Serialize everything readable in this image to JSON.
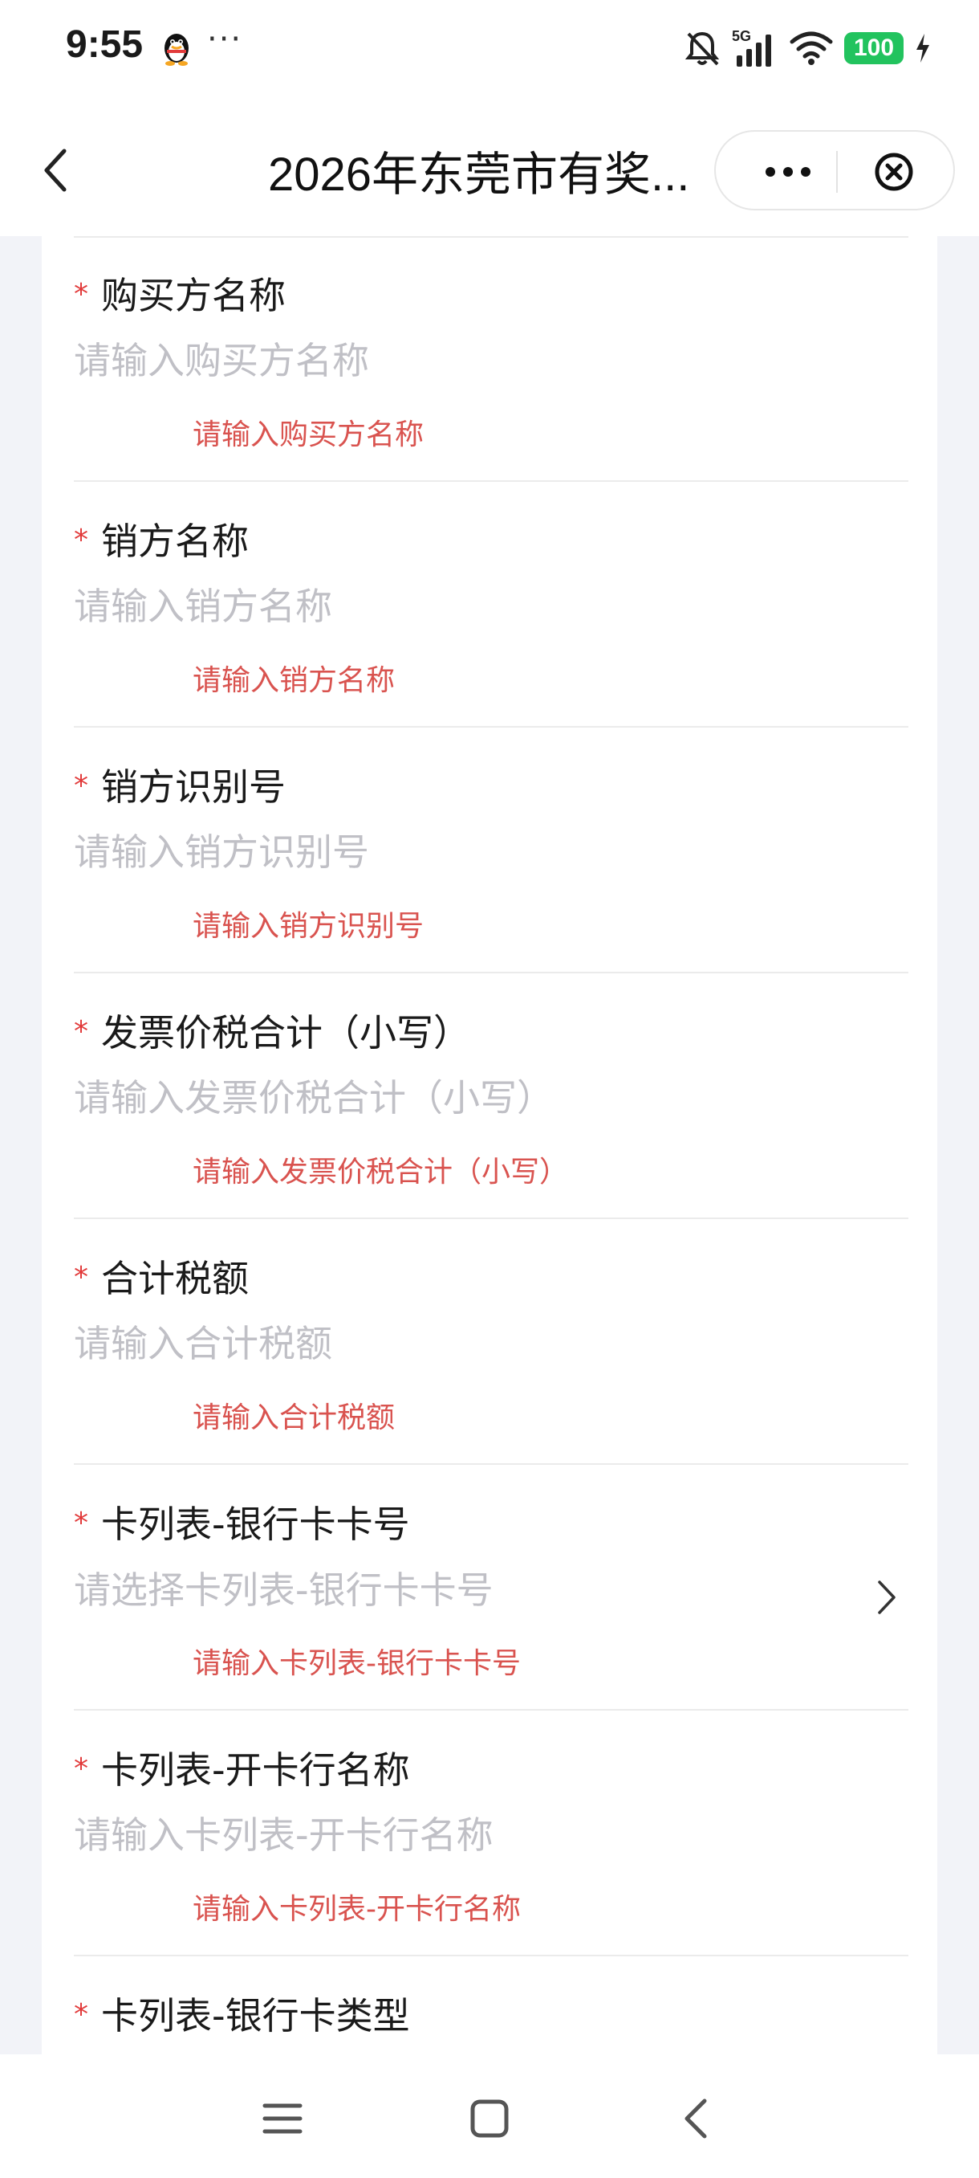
{
  "status_bar": {
    "time": "9:55",
    "dots": "···",
    "network": "5G",
    "battery": "100",
    "icons": [
      "qq-penguin-icon",
      "bell-muted-icon",
      "signal-icon",
      "wifi-icon",
      "battery-icon",
      "charging-bolt-icon"
    ]
  },
  "header": {
    "title": "2026年东莞市有奖...",
    "icons": [
      "back-arrow-icon",
      "more-dots-icon",
      "close-circle-icon"
    ]
  },
  "form": {
    "items": [
      {
        "label": "购买方名称",
        "placeholder": "请输入购买方名称",
        "error": "请输入购买方名称",
        "required": true,
        "type": "input"
      },
      {
        "label": "销方名称",
        "placeholder": "请输入销方名称",
        "error": "请输入销方名称",
        "required": true,
        "type": "input"
      },
      {
        "label": "销方识别号",
        "placeholder": "请输入销方识别号",
        "error": "请输入销方识别号",
        "required": true,
        "type": "input"
      },
      {
        "label": "发票价税合计（小写）",
        "placeholder": "请输入发票价税合计（小写）",
        "error": "请输入发票价税合计（小写）",
        "required": true,
        "type": "input"
      },
      {
        "label": "合计税额",
        "placeholder": "请输入合计税额",
        "error": "请输入合计税额",
        "required": true,
        "type": "input"
      },
      {
        "label": "卡列表-银行卡卡号",
        "placeholder": "请选择卡列表-银行卡卡号",
        "error": "请输入卡列表-银行卡卡号",
        "required": true,
        "type": "select"
      },
      {
        "label": "卡列表-开卡行名称",
        "placeholder": "请输入卡列表-开卡行名称",
        "error": "请输入卡列表-开卡行名称",
        "required": true,
        "type": "input"
      },
      {
        "label": "卡列表-银行卡类型",
        "required": true,
        "type": "input"
      }
    ],
    "required_mark": "*"
  },
  "nav_bar": {
    "icons": [
      "menu-icon",
      "home-square-icon",
      "back-triangle-icon"
    ]
  },
  "colors": {
    "required": "#e23b3b",
    "error": "#d9534f",
    "placeholder": "#c0c0c6",
    "battery": "#22c35e",
    "background": "#f2f3f8"
  }
}
